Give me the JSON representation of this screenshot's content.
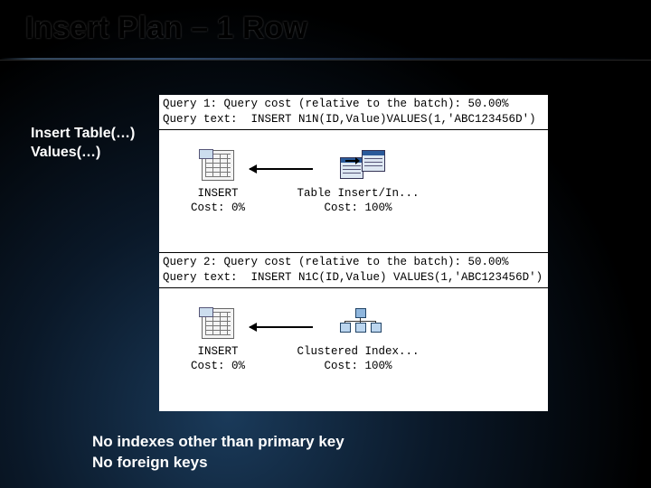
{
  "title": "Insert Plan – 1 Row",
  "sidebar": {
    "line1": "Insert Table(…)",
    "line2": "Values(…)"
  },
  "queries": [
    {
      "header_line1": "Query 1: Query cost (relative to the batch): 50.00%",
      "header_line2": "Query text:  INSERT N1N(ID,Value)VALUES(1,'ABC123456D')",
      "ops": [
        {
          "name": "INSERT",
          "cost": "Cost: 0%",
          "icon": "insert"
        },
        {
          "name": "Table Insert/In...",
          "cost": "Cost: 100%",
          "icon": "tableinsert"
        }
      ]
    },
    {
      "header_line1": "Query 2: Query cost (relative to the batch): 50.00%",
      "header_line2": "Query text:  INSERT N1C(ID,Value) VALUES(1,'ABC123456D')",
      "ops": [
        {
          "name": "INSERT",
          "cost": "Cost: 0%",
          "icon": "insert"
        },
        {
          "name": "Clustered Index...",
          "cost": "Cost: 100%",
          "icon": "clustered"
        }
      ]
    }
  ],
  "footnotes": {
    "line1": "No indexes other than primary key",
    "line2": "No foreign keys"
  }
}
